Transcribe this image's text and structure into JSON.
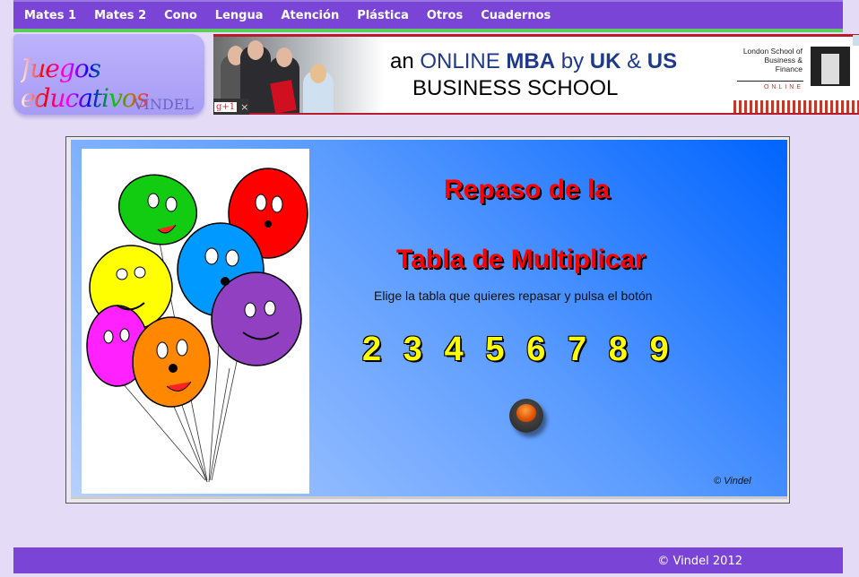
{
  "nav": {
    "items": [
      "Mates 1",
      "Mates 2",
      "Cono",
      "Lengua",
      "Atención",
      "Plástica",
      "Otros",
      "Cuadernos"
    ]
  },
  "logo": {
    "title": "Juegos educativos",
    "subtitle": "VINDEL"
  },
  "ad": {
    "line1_prefix": "an",
    "line1_online": "ONLINE",
    "line1_mba": "MBA",
    "line1_by": "by",
    "line1_uk": "UK",
    "line1_amp": "&",
    "line1_us": "US",
    "line2": "BUSINESS SCHOOL",
    "school": "London School of Business & Finance",
    "online_tag": "ONLINE",
    "gplus": "g+1",
    "close": "×"
  },
  "game": {
    "title_line1": "Repaso de la",
    "title_line2": "Tabla de Multiplicar",
    "instruction": "Elige la tabla que quieres repasar y pulsa el botón",
    "tables": [
      "2",
      "3",
      "4",
      "5",
      "6",
      "7",
      "8",
      "9"
    ],
    "copyright": "© Vindel"
  },
  "colors": {
    "nav": "#7a45d6",
    "title": "#ff0000",
    "numbers": "#ffff00"
  },
  "footer": {
    "text": "© Vindel 2012"
  }
}
